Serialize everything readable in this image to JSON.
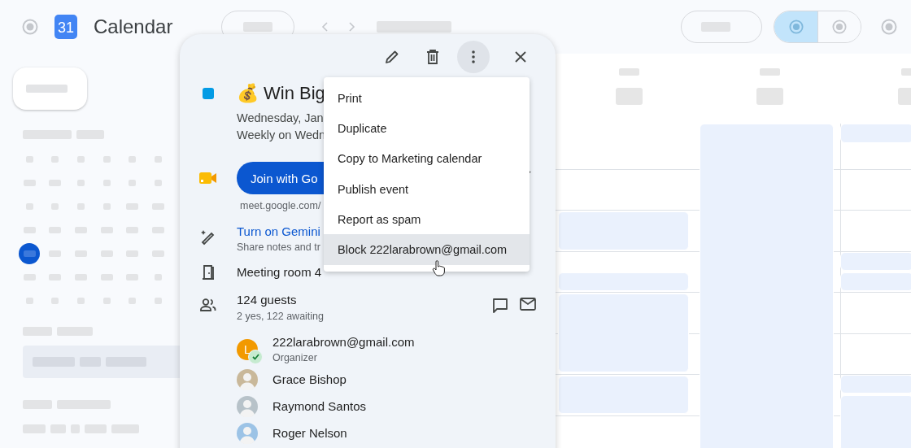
{
  "app": {
    "logo_text": "31",
    "title": "Calendar"
  },
  "view_switch": [
    {
      "selected": true
    },
    {
      "selected": false
    }
  ],
  "event": {
    "color": "#039be5",
    "emoji": "💰",
    "title": "Win Big",
    "date": "Wednesday, Jan",
    "recurrence": "Weekly on Wedn",
    "join_button": "Join with Go",
    "meet_link": "meet.google.com/",
    "gemini": {
      "title": "Turn on Gemini",
      "subtitle": "Share notes and tr"
    },
    "room": "Meeting room 4",
    "guests": {
      "count": "124 guests",
      "summary": "2 yes, 122 awaiting",
      "list": [
        {
          "kind": "initial",
          "initial": "L",
          "color": "#f29900",
          "name": "222larabrown@gmail.com",
          "role": "Organizer",
          "accepted": true
        },
        {
          "kind": "photo",
          "name": "Grace Bishop",
          "accepted": false
        },
        {
          "kind": "photo",
          "name": "Raymond Santos",
          "accepted": false
        },
        {
          "kind": "photo",
          "name": "Roger Nelson",
          "accepted": false
        }
      ]
    }
  },
  "menu": {
    "items": [
      {
        "label": "Print",
        "selected": false
      },
      {
        "label": "Duplicate",
        "selected": false
      },
      {
        "label": "Copy to Marketing calendar",
        "selected": false
      },
      {
        "label": "Publish event",
        "selected": false
      },
      {
        "label": "Report as spam",
        "selected": false
      },
      {
        "label": "Block 222larabrown@gmail.com",
        "selected": true
      }
    ]
  }
}
